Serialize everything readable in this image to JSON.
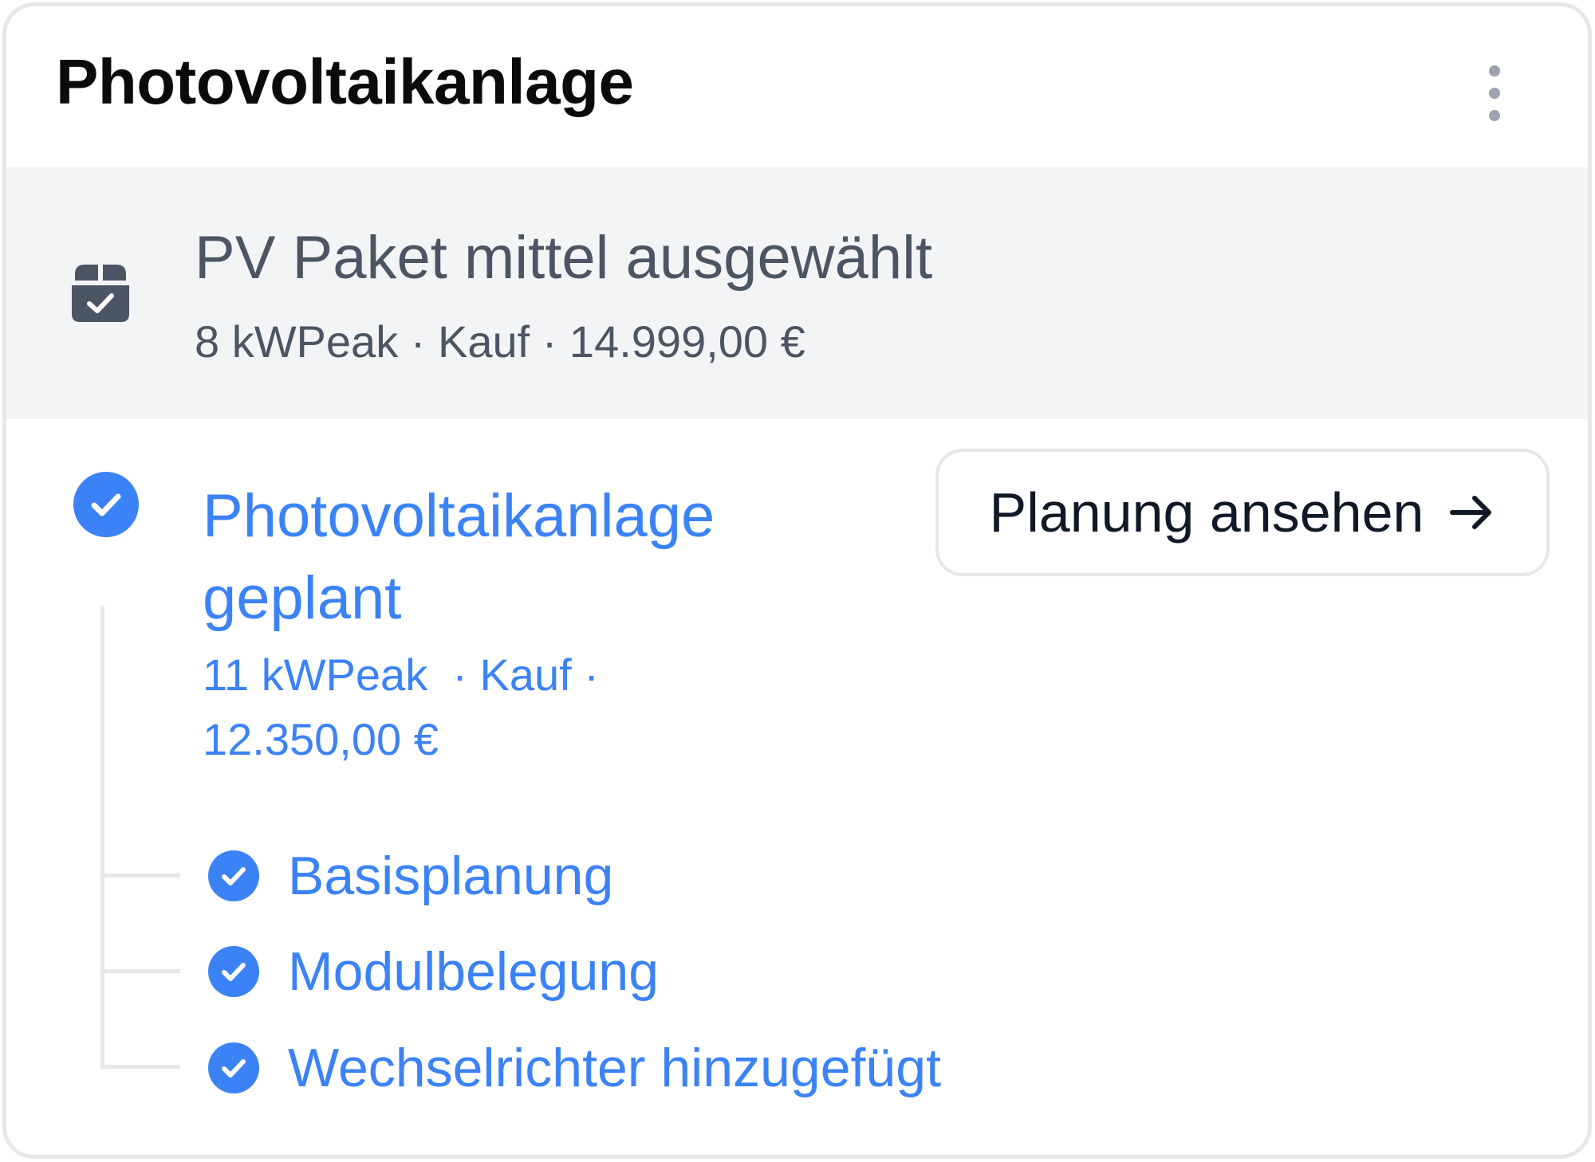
{
  "card": {
    "title": "Photovoltaikanlage",
    "menu_icon": "more-vertical-icon"
  },
  "selected_package": {
    "icon": "package-check-icon",
    "title": "PV Paket mittel ausgewählt",
    "details": "8 kWPeak · Kauf · 14.999,00 €"
  },
  "planned": {
    "icon": "check-circle-icon",
    "title_line1": "Photovoltaikanlage",
    "title_line2": "geplant",
    "details_line1": "11 kWPeak  · Kauf ·",
    "details_line2": "12.350,00 €",
    "button_label": "Planung ansehen",
    "button_icon": "arrow-right-icon",
    "steps": [
      {
        "label": "Basisplanung",
        "icon": "check-circle-icon"
      },
      {
        "label": "Modulbelegung",
        "icon": "check-circle-icon"
      },
      {
        "label": "Wechselrichter hinzugefügt",
        "icon": "check-circle-icon"
      }
    ]
  },
  "colors": {
    "accent_blue": "#3b82f6",
    "muted_gray": "#4b5563",
    "band_gray": "#f3f4f6",
    "border_gray": "#e5e7eb"
  }
}
